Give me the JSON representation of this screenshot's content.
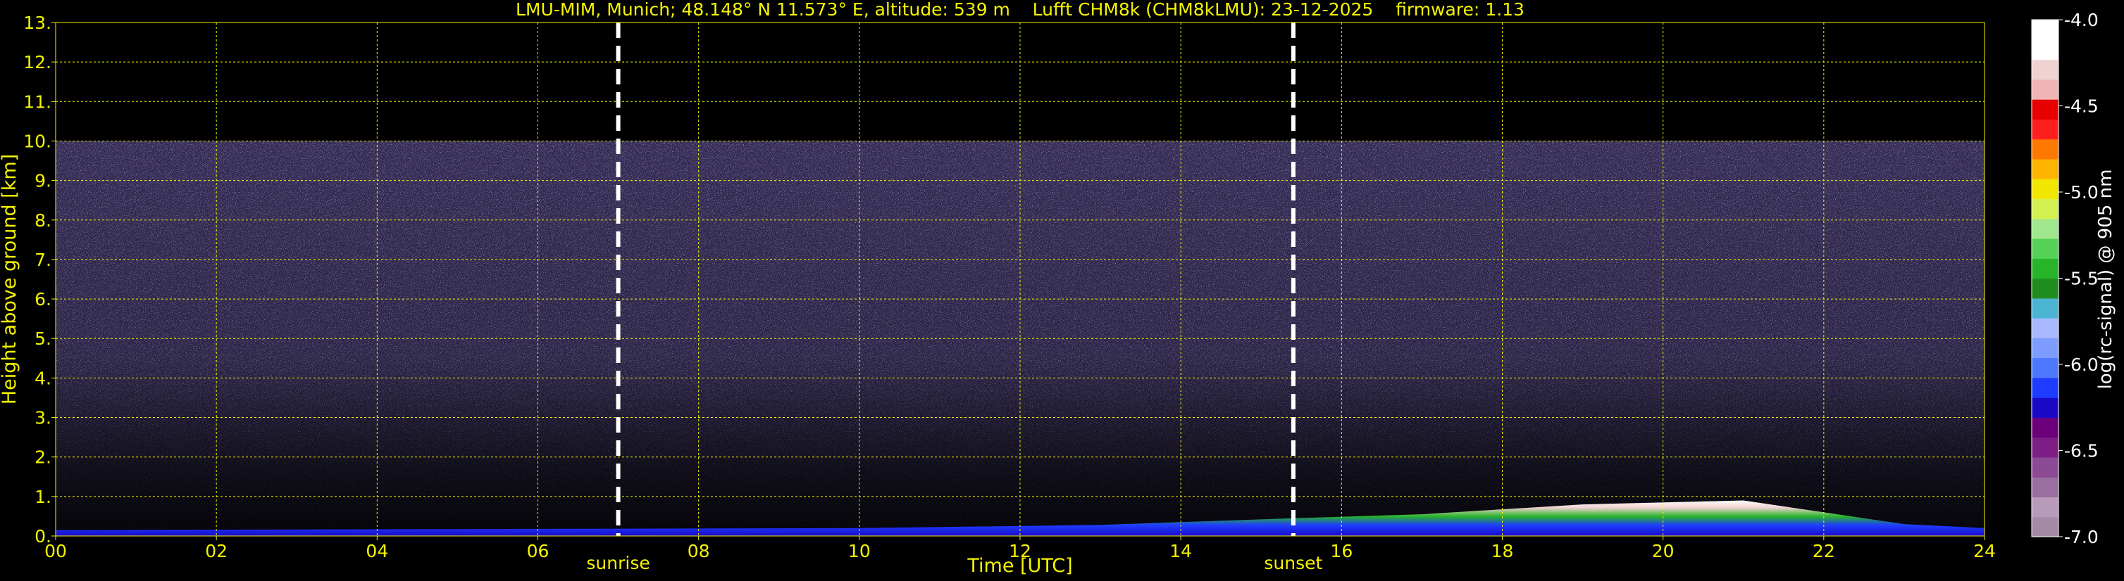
{
  "chart_data": {
    "type": "heatmap",
    "title": "LMU-MIM, Munich; 48.148° N 11.573° E, altitude: 539 m    Lufft CHM8k (CHM8kLMU): 23-12-2025    firmware: 1.13",
    "xlabel": "Time [UTC]",
    "ylabel": "Height above ground [km]",
    "xlim": [
      0,
      24
    ],
    "ylim": [
      0,
      13
    ],
    "x_ticks": [
      "00",
      "02",
      "04",
      "06",
      "08",
      "10",
      "12",
      "14",
      "16",
      "18",
      "20",
      "22",
      "24"
    ],
    "y_ticks": [
      "0.",
      "1.",
      "2.",
      "3.",
      "4.",
      "5.",
      "6.",
      "7.",
      "8.",
      "9.",
      "10.",
      "11.",
      "12.",
      "13."
    ],
    "grid": true,
    "grid_color": "#f5f500",
    "background": "#000000",
    "signal_top_km": 10.0,
    "markers": [
      {
        "label": "sunrise",
        "x": 7.0
      },
      {
        "label": "sunset",
        "x": 15.4
      }
    ],
    "colorbar": {
      "label": "log(rc-signal) @ 905 nm",
      "ticks": [
        "-4.0",
        "-4.5",
        "-5.0",
        "-5.5",
        "-6.0",
        "-6.5",
        "-7.0"
      ],
      "range": [
        -7.0,
        -4.0
      ],
      "colors": [
        "#a58aa7",
        "#b89bbb",
        "#9b6ea1",
        "#8b4a93",
        "#7d1f86",
        "#6b007a",
        "#1a0ac8",
        "#1e3cff",
        "#4b78ff",
        "#7d9cff",
        "#a7b8ff",
        "#4bb4d2",
        "#1e8c1e",
        "#28b428",
        "#55d255",
        "#a0e68c",
        "#d2f050",
        "#f0e600",
        "#ffb400",
        "#ff7800",
        "#ff1e1e",
        "#e60000",
        "#f0b4b4",
        "#f0d2d2",
        "#ffffff",
        "#ffffff"
      ]
    },
    "boundary_layer_km": [
      {
        "t": 0,
        "h": 0.15
      },
      {
        "t": 6,
        "h": 0.18
      },
      {
        "t": 10,
        "h": 0.2
      },
      {
        "t": 13,
        "h": 0.28
      },
      {
        "t": 15.4,
        "h": 0.45
      },
      {
        "t": 17,
        "h": 0.55
      },
      {
        "t": 19,
        "h": 0.8
      },
      {
        "t": 21,
        "h": 0.9
      },
      {
        "t": 23,
        "h": 0.3
      },
      {
        "t": 24,
        "h": 0.2
      }
    ]
  }
}
